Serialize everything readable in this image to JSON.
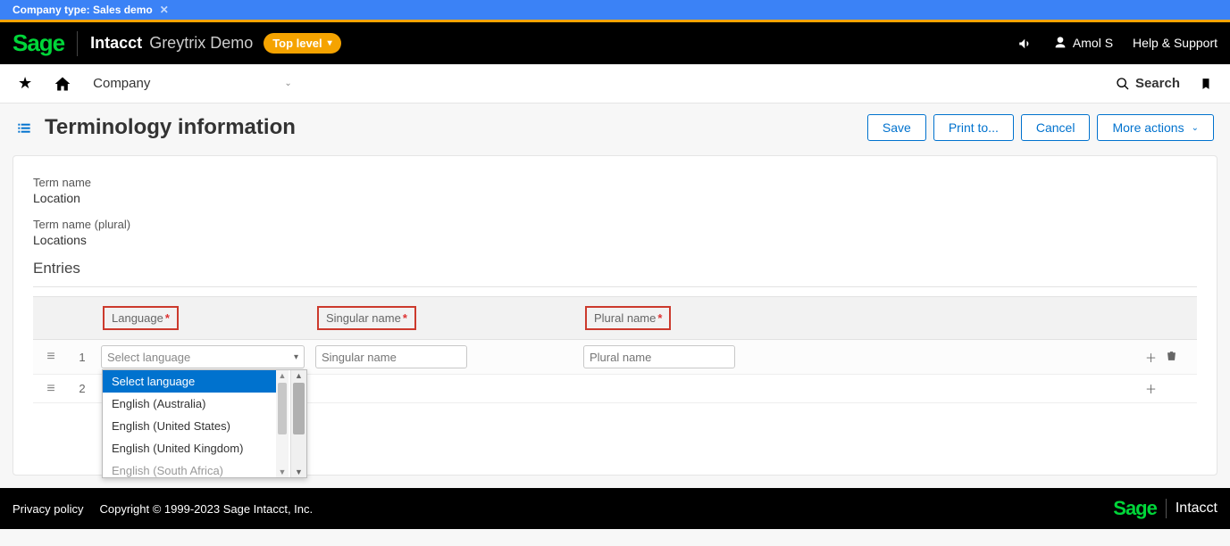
{
  "banner": {
    "text": "Company type: Sales demo"
  },
  "topbar": {
    "logo": "Sage",
    "product": "Intacct",
    "company": "Greytrix Demo",
    "level": "Top level",
    "user": "Amol S",
    "help": "Help & Support"
  },
  "menubar": {
    "module": "Company",
    "search": "Search"
  },
  "page": {
    "title": "Terminology information",
    "actions": {
      "save": "Save",
      "print": "Print to...",
      "cancel": "Cancel",
      "more": "More actions"
    }
  },
  "form": {
    "term_name_label": "Term name",
    "term_name_value": "Location",
    "term_plural_label": "Term name (plural)",
    "term_plural_value": "Locations",
    "entries_title": "Entries"
  },
  "table": {
    "cols": {
      "language": "Language",
      "singular": "Singular name",
      "plural": "Plural name"
    },
    "rows": [
      {
        "num": "1",
        "lang_placeholder": "Select language",
        "sing_placeholder": "Singular name",
        "plur_placeholder": "Plural name"
      },
      {
        "num": "2"
      }
    ],
    "dropdown": {
      "options": [
        "Select language",
        "English (Australia)",
        "English (United States)",
        "English (United Kingdom)",
        "English (South Africa)"
      ]
    }
  },
  "footer": {
    "privacy": "Privacy policy",
    "copyright": "Copyright © 1999-2023 Sage Intacct, Inc.",
    "brand": "Sage",
    "product": "Intacct"
  }
}
